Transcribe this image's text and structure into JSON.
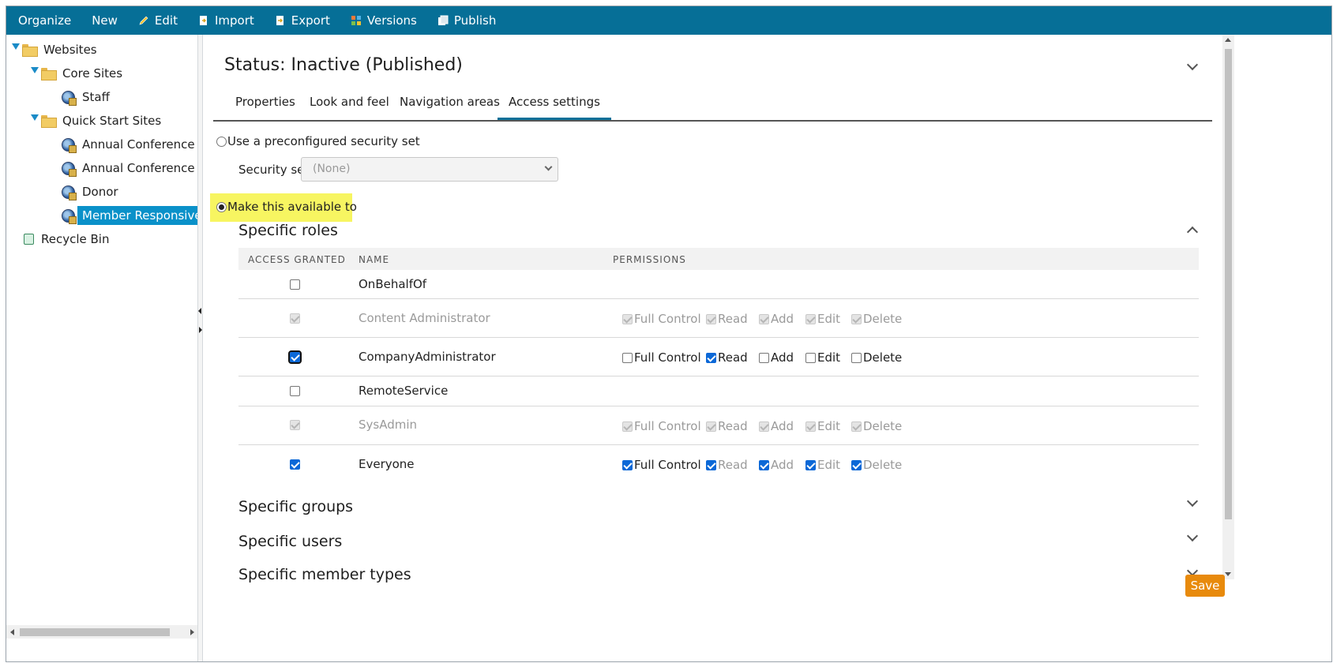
{
  "toolbar": {
    "items": [
      {
        "label": "Organize",
        "icon": ""
      },
      {
        "label": "New",
        "icon": ""
      },
      {
        "label": "Edit",
        "icon": "pencil-icon"
      },
      {
        "label": "Import",
        "icon": "import-icon"
      },
      {
        "label": "Export",
        "icon": "export-icon"
      },
      {
        "label": "Versions",
        "icon": "versions-icon"
      },
      {
        "label": "Publish",
        "icon": "publish-icon"
      }
    ],
    "bg_color": "#066f97"
  },
  "tree": {
    "websites": "Websites",
    "core_sites": "Core Sites",
    "staff": "Staff",
    "quick_start_sites": "Quick Start Sites",
    "annual_conference": "Annual Conference",
    "annual_conference_mobile": "Annual Conference Mobile",
    "donor": "Donor",
    "member_responsive": "Member Responsive",
    "recycle_bin": "Recycle Bin"
  },
  "main": {
    "status_title": "Status: Inactive (Published)",
    "tabs": [
      "Properties",
      "Look and feel",
      "Navigation areas",
      "Access settings"
    ],
    "active_tab": "Access settings",
    "use_preconfigured_label": "Use a preconfigured security set",
    "security_set_label": "Security set",
    "security_set_value": "(None)",
    "make_available_label": "Make this available to",
    "specific_roles_title": "Specific roles",
    "columns": [
      "ACCESS GRANTED",
      "NAME",
      "PERMISSIONS"
    ],
    "permission_labels": [
      "Full Control",
      "Read",
      "Add",
      "Edit",
      "Delete"
    ],
    "roles": [
      {
        "name": "OnBehalfOf",
        "granted": false,
        "disabled": false,
        "perms": null
      },
      {
        "name": "Content Administrator",
        "granted": true,
        "disabled": true,
        "perms": [
          true,
          true,
          true,
          true,
          true
        ]
      },
      {
        "name": "CompanyAdministrator",
        "granted": true,
        "disabled": false,
        "perms": [
          false,
          true,
          false,
          false,
          false
        ]
      },
      {
        "name": "RemoteService",
        "granted": false,
        "disabled": false,
        "perms": null
      },
      {
        "name": "SysAdmin",
        "granted": true,
        "disabled": true,
        "perms": [
          true,
          true,
          true,
          true,
          true
        ]
      },
      {
        "name": "Everyone",
        "granted": true,
        "disabled": false,
        "perms": [
          true,
          true,
          true,
          true,
          true
        ]
      }
    ],
    "specific_groups_title": "Specific groups",
    "specific_users_title": "Specific users",
    "specific_members_title": "Specific member types"
  },
  "save_label": "Save",
  "colors": {
    "accent": "#066f97",
    "selection": "#0a91c9",
    "highlight": "#f7f561",
    "save": "#e88a0c"
  }
}
